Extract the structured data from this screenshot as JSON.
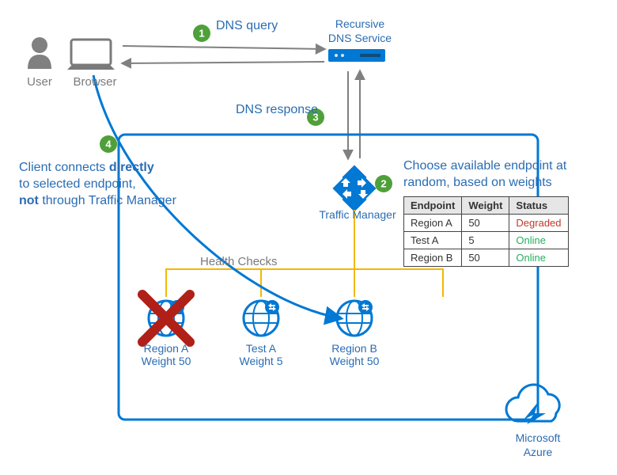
{
  "labels": {
    "user": "User",
    "browser": "Browser",
    "dns_query": "DNS query",
    "dns_response": "DNS response",
    "recursive_dns_line1": "Recursive",
    "recursive_dns_line2": "DNS Service",
    "traffic_manager": "Traffic Manager",
    "health_checks": "Health Checks",
    "microsoft_azure_line1": "Microsoft",
    "microsoft_azure_line2": "Azure"
  },
  "steps": {
    "s1": "1",
    "s2": "2",
    "s3": "3",
    "s4": "4"
  },
  "note_step4": {
    "line1_pre": "Client connects ",
    "line1_strong": "directly",
    "line2": "to selected endpoint,",
    "line3_strong": "not",
    "line3_post": " through Traffic Manager"
  },
  "note_step2": {
    "line1": "Choose available endpoint at",
    "line2": "random, based on weights"
  },
  "table": {
    "headers": {
      "endpoint": "Endpoint",
      "weight": "Weight",
      "status": "Status"
    },
    "rows": [
      {
        "endpoint": "Region A",
        "weight": "50",
        "status": "Degraded",
        "status_class": "status-red"
      },
      {
        "endpoint": "Test A",
        "weight": "5",
        "status": "Online",
        "status_class": "status-green"
      },
      {
        "endpoint": "Region B",
        "weight": "50",
        "status": "Online",
        "status_class": "status-green"
      }
    ]
  },
  "endpoints": {
    "a": {
      "name": "Region A",
      "weight": "Weight 50",
      "failed": true
    },
    "t": {
      "name": "Test A",
      "weight": "Weight 5",
      "failed": false
    },
    "b": {
      "name": "Region B",
      "weight": "Weight 50",
      "failed": false
    }
  },
  "colors": {
    "azure_blue": "#0078d4",
    "step_green": "#4fa03a",
    "label_blue": "#2a6cb3",
    "gray": "#808080",
    "yellow": "#f2b800",
    "fail_red": "#b02018"
  }
}
